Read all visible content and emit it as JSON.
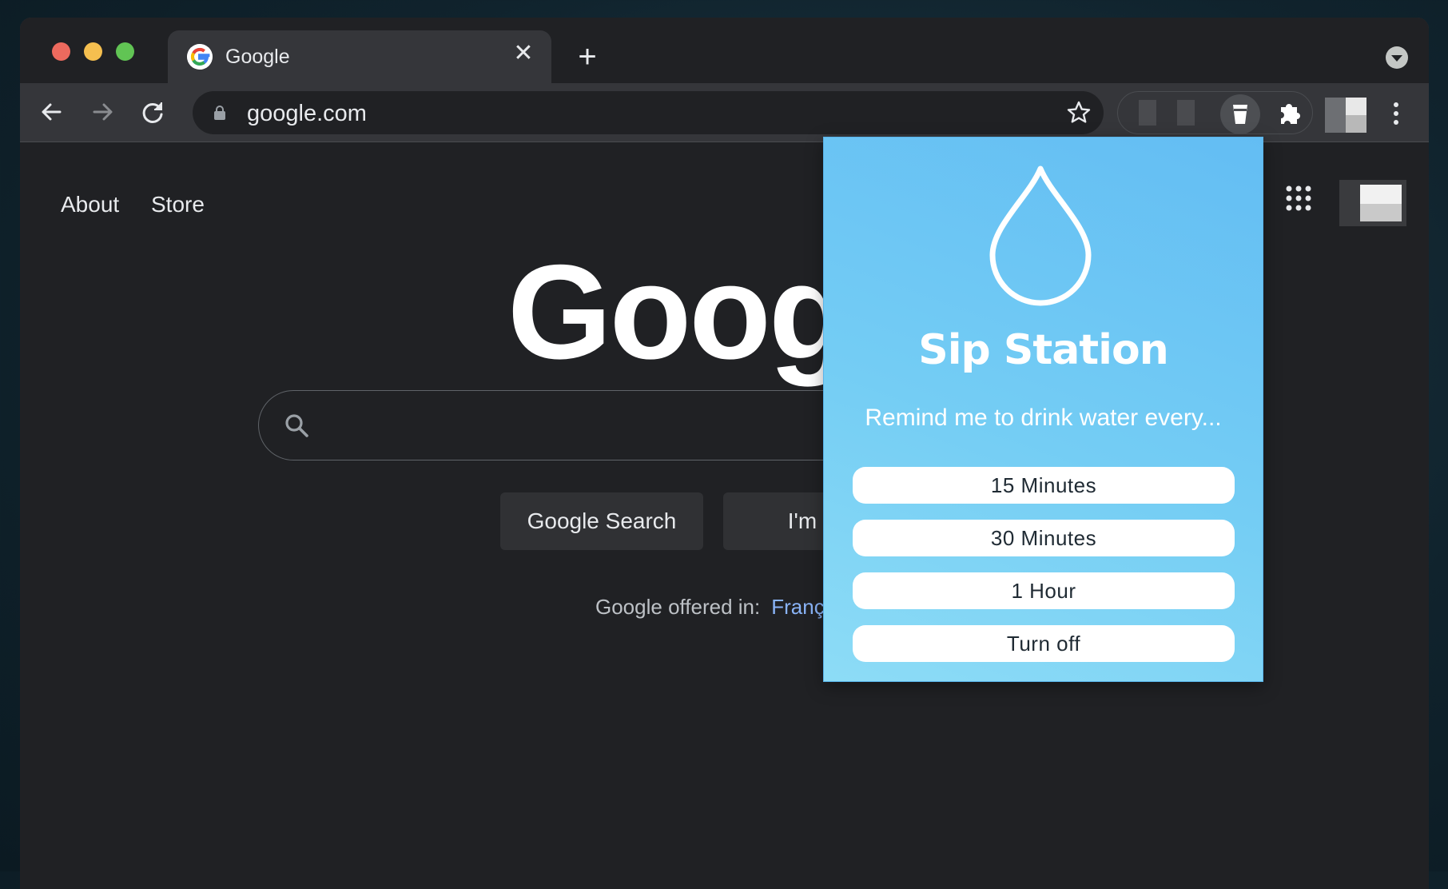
{
  "browser": {
    "tab": {
      "title": "Google",
      "close_glyph": "✕"
    },
    "new_tab_glyph": "+",
    "address": {
      "url": "google.com"
    },
    "icons": [
      "back-icon",
      "forward-icon",
      "reload-icon",
      "lock-icon",
      "bookmark-star-icon",
      "puzzle-icon",
      "kebab-menu-icon"
    ]
  },
  "page": {
    "nav": {
      "about": "About",
      "store": "Store"
    },
    "logo_text": "Goog",
    "buttons": {
      "search": "Google Search",
      "lucky": "I'm Fee"
    },
    "offered": {
      "label": "Google offered in:",
      "language": "Franç"
    }
  },
  "popup": {
    "title": "Sip Station",
    "subtitle": "Remind me to drink water every...",
    "options": [
      "15 Minutes",
      "30 Minutes",
      "1 Hour",
      "Turn off"
    ]
  },
  "colors": {
    "popup_gradient_start": "#63bdf3",
    "popup_gradient_end": "#8ddcf6",
    "link": "#8ab4f8"
  }
}
